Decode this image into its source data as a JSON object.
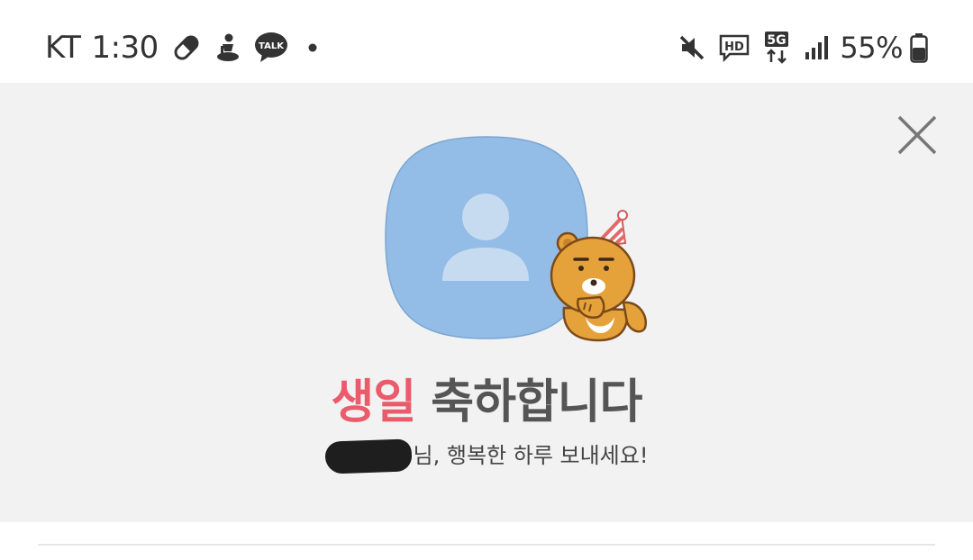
{
  "status_bar": {
    "carrier": "KT",
    "time": "1:30",
    "talk_badge": "TALK",
    "hd_badge": "HD",
    "network": "5G",
    "battery": "55%",
    "icons": [
      "pill-icon",
      "figure-icon",
      "kakaotalk-icon",
      "notification-dot-icon",
      "mute-icon",
      "hd-voice-icon",
      "5g-data-icon",
      "signal-icon",
      "battery-icon"
    ]
  },
  "birthday": {
    "title_highlight": "생일",
    "title_rest": " 축하합니다",
    "subtitle": "님, 행복한 하루 보내세요!",
    "close_icon": "close-icon",
    "avatar_icon": "default-profile-icon",
    "sticker": "party-bear-sticker"
  },
  "colors": {
    "banner_bg": "#f2f2f2",
    "avatar_bg": "#93bde6",
    "highlight": "#ea5b6b",
    "title_text": "#555555"
  }
}
